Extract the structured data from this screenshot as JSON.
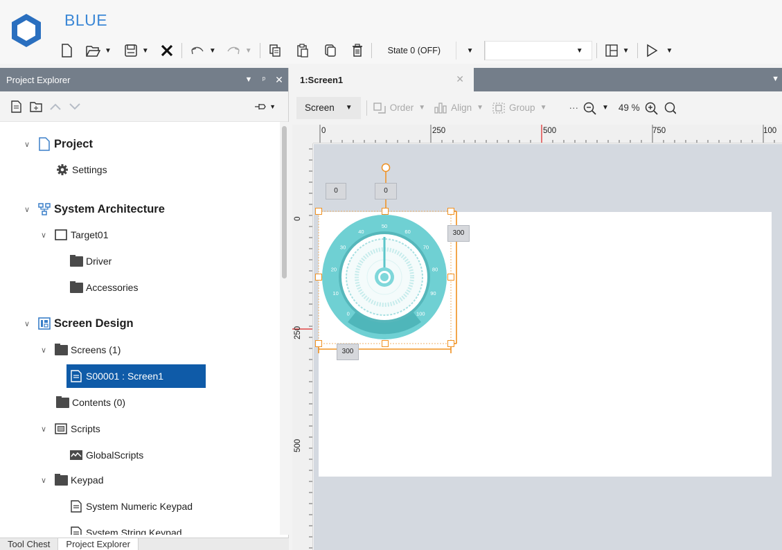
{
  "app": {
    "name": "BLUE"
  },
  "toolbar": {
    "state_value": "State 0 (OFF)",
    "blank_combo_value": ""
  },
  "project_explorer": {
    "title": "Project Explorer",
    "tree": {
      "project": "Project",
      "settings": "Settings",
      "system_architecture": "System Architecture",
      "target": "Target01",
      "driver": "Driver",
      "accessories": "Accessories",
      "screen_design": "Screen Design",
      "screens": "Screens (1)",
      "screen1": "S00001 : Screen1",
      "contents": "Contents (0)",
      "scripts": "Scripts",
      "global_scripts": "GlobalScripts",
      "keypad": "Keypad",
      "numeric_keypad": "System Numeric Keypad",
      "string_keypad": "System String Keypad"
    },
    "bottom_tabs": [
      "Tool Chest",
      "Project Explorer"
    ]
  },
  "document": {
    "tab_title": "1:Screen1"
  },
  "designer_toolbar": {
    "screen_combo": "Screen",
    "order": "Order",
    "align": "Align",
    "group": "Group",
    "more": "···",
    "zoom": "49 %"
  },
  "rulers": {
    "top_labels": [
      "0",
      "250",
      "500",
      "750",
      "100"
    ],
    "left_labels": [
      "0",
      "250",
      "500"
    ]
  },
  "gauge": {
    "scale_labels": [
      "0",
      "10",
      "20",
      "30",
      "40",
      "50",
      "60",
      "70",
      "80",
      "90",
      "100"
    ],
    "value": 50,
    "x": "0",
    "y": "0",
    "width": "300",
    "height": "300",
    "accent_color": "#5bc8cc"
  }
}
